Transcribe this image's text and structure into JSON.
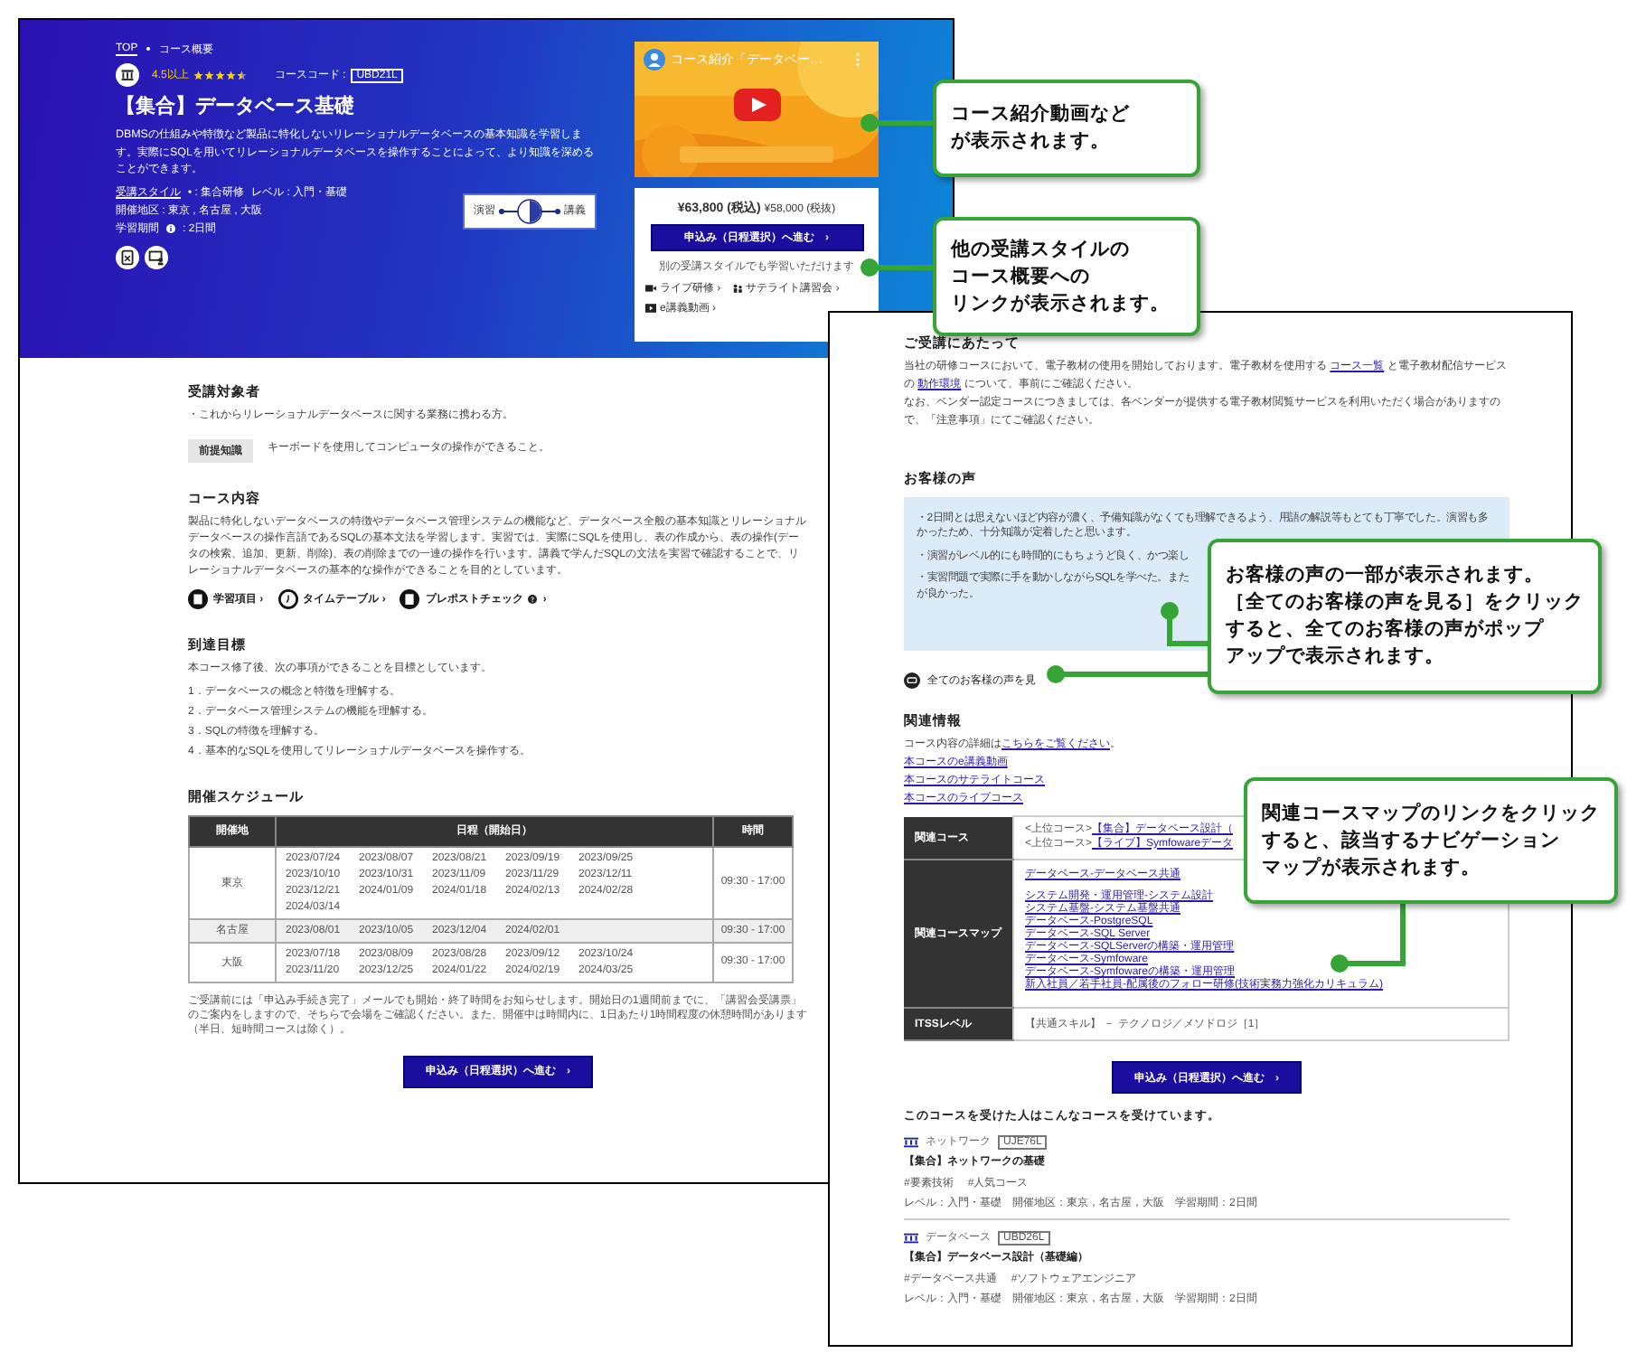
{
  "left_page": {
    "breadcrumb": [
      "TOP",
      "コース概要"
    ],
    "rating": {
      "label": "4.5以上",
      "stars": 4.5
    },
    "code_label": "コースコード :",
    "code": "UBD21L",
    "title": "【集合】データベース基礎",
    "description": "DBMSの仕組みや特徴など製品に特化しないリレーショナルデータベースの基本知識を学習します。実際にSQLを用いてリレーショナルデータベースを操作することによって、より知識を深めることができます。",
    "meta_lines": [
      [
        {
          "kind": "link",
          "text": "受講スタイル"
        },
        {
          "kind": "text",
          "text": "• : 集合研修"
        },
        {
          "kind": "text",
          "text": "レベル : 入門・基礎"
        }
      ],
      [
        {
          "kind": "text",
          "text": "開催地区 : 東京 , 名古屋 , 大阪"
        }
      ],
      [
        {
          "kind": "text",
          "text": "学習期間"
        },
        {
          "kind": "info"
        },
        {
          "kind": "text",
          "text": ": 2日間"
        }
      ]
    ],
    "ratio": {
      "left": "演習",
      "right": "講義",
      "level": 0.5
    },
    "video": {
      "title": "コース紹介「データベー…"
    },
    "price": {
      "main": "¥63,800 (税込)",
      "sub": "¥58,000 (税抜)",
      "button": "申込み（日程選択）へ進む　›",
      "note": "別の受講スタイルでも学習いただけます",
      "styles": [
        {
          "kind": "live",
          "text": "ライブ研修 ›"
        },
        {
          "kind": "satellite",
          "text": "サテライト講習会 ›"
        },
        {
          "kind": "elearning",
          "text": "e講義動画 ›"
        }
      ]
    },
    "audience": {
      "heading": "受講対象者",
      "bullet": "・これからリレーショナルデータベースに関する業務に携わる方。",
      "tag": "前提知識",
      "prereq": "キーボードを使用してコンピュータの操作ができること。"
    },
    "content": {
      "heading": "コース内容",
      "text": "製品に特化しないデータベースの特徴やデータベース管理システムの機能など、データベース全般の基本知識とリレーショナルデータベースの操作言語であるSQLの基本文法を学習します。実習では、実際にSQLを使用し、表の作成から、表の操作(データの検索、追加、更新、削除)、表の削除までの一連の操作を行います。講義で学んだSQLの文法を実習で確認することで、リレーショナルデータベースの基本的な操作ができることを目的としています。",
      "links": [
        {
          "kind": "items",
          "text": "学習項目",
          "arrow": "›",
          "help": false
        },
        {
          "kind": "timetable",
          "text": "タイムテーブル",
          "arrow": "›",
          "help": false
        },
        {
          "kind": "check",
          "text": "プレポストチェック",
          "arrow": "›",
          "help": true
        }
      ]
    },
    "goals": {
      "heading": "到達目標",
      "intro": "本コース修了後、次の事項ができることを目標としています。",
      "items": [
        "1．データベースの概念と特徴を理解する。",
        "2．データベース管理システムの機能を理解する。",
        "3．SQLの特徴を理解する。",
        "4．基本的なSQLを使用してリレーショナルデータベースを操作する。"
      ]
    },
    "schedule": {
      "heading": "開催スケジュール",
      "columns": [
        "開催地",
        "日程（開始日）",
        "時間"
      ],
      "rows": [
        {
          "place": "東京",
          "shaded": false,
          "time": "09:30 - 17:00",
          "dates": [
            "2023/07/24",
            "2023/08/07",
            "2023/08/21",
            "2023/09/19",
            "2023/09/25",
            "2023/10/10",
            "2023/10/31",
            "2023/11/09",
            "2023/11/29",
            "2023/12/11",
            "2023/12/21",
            "2024/01/09",
            "2024/01/18",
            "2024/02/13",
            "2024/02/28",
            "2024/03/14"
          ]
        },
        {
          "place": "名古屋",
          "shaded": true,
          "time": "09:30 - 17:00",
          "dates": [
            "2023/08/01",
            "2023/10/05",
            "2023/12/04",
            "2024/02/01"
          ]
        },
        {
          "place": "大阪",
          "shaded": false,
          "time": "09:30 - 17:00",
          "dates": [
            "2023/07/18",
            "2023/08/09",
            "2023/08/28",
            "2023/09/12",
            "2023/10/24",
            "2023/11/20",
            "2023/12/25",
            "2024/01/22",
            "2024/02/19",
            "2024/03/25"
          ]
        }
      ],
      "note": "ご受講前には「申込み手続き完了」メールでも開始・終了時間をお知らせします。開始日の1週間前までに、「講習会受講票」のご案内をしますので、そちらで会場をご確認ください。また、開催中は時間内に、1日あたり1時間程度の休憩時間があります（半日、短時間コースは除く）。",
      "button": "申込み（日程選択）へ進む　›"
    }
  },
  "right_page": {
    "notice": {
      "heading": "ご受講にあたって",
      "segments": [
        {
          "kind": "text",
          "text": "当社の研修コースにおいて、電子教材の使用を開始しております。電子教材を使用する "
        },
        {
          "kind": "link",
          "text": "コース一覧"
        },
        {
          "kind": "text",
          "text": " と電子教材配信サービスの "
        },
        {
          "kind": "link",
          "text": "動作環境"
        },
        {
          "kind": "text",
          "text": " について、事前にご確認ください。"
        }
      ],
      "note": "なお、ベンダー認定コースにつきましては、各ベンダーが提供する電子教材閲覧サービスを利用いただく場合がありますので、「注意事項」にてご確認ください。"
    },
    "voices": {
      "heading": "お客様の声",
      "items": [
        {
          "lines": [
            "・2日間とは思えないほど内容が濃く、予備知識がなくても理解できるよう、用語の解説等もとても丁寧でした。演習も多かったため、十分知識が定着したと思います。"
          ]
        },
        {
          "lines": [
            "・演習がレベル的にも時間的にもちょうど良く、かつ楽し"
          ]
        },
        {
          "lines": [
            "・実習問題で実際に手を動かしながらSQLを学べた。また",
            "が良かった。"
          ]
        }
      ],
      "more": "全てのお客様の声を見"
    },
    "related": {
      "heading": "関連情報",
      "intro": [
        {
          "kind": "text",
          "text": "コース内容の詳細は"
        },
        {
          "kind": "link",
          "text": "こちらをご覧ください"
        },
        {
          "kind": "text",
          "text": "。"
        }
      ],
      "links": [
        "本コースのe講義動画",
        "本コースのサテライトコース",
        "本コースのライブコース"
      ],
      "rows": [
        {
          "kind": "courses",
          "header": "関連コース",
          "items": [
            {
              "prefix": "<上位コース>",
              "link": "【集合】データベース設計（"
            },
            {
              "prefix": "<上位コース>",
              "link": "【ライブ】Symfowareデータ"
            }
          ]
        },
        {
          "kind": "links",
          "header": "関連コースマップ",
          "groups": [
            [
              "データベース-データベース共通"
            ],
            [
              "システム開発・運用管理-システム設計",
              "システム基盤-システム基盤共通",
              "データベース-PostgreSQL",
              "データベース-SQL Server",
              "データベース-SQLServerの構築・運用管理",
              "データベース-Symfoware",
              "データベース-Symfowareの構築・運用管理",
              "新入社員／若手社員-配属後のフォロー研修(技術実務力強化カリキュラム)"
            ]
          ]
        },
        {
          "kind": "text",
          "header": "ITSSレベル",
          "text": "【共通スキル】 － テクノロジ／メソドロジ［1］"
        }
      ]
    },
    "button": "申込み（日程選択）へ進む　›",
    "others": {
      "heading": "このコースを受けた人はこんなコースを受けています。",
      "courses": [
        {
          "category": "ネットワーク",
          "code": "UJE76L",
          "title": "【集合】ネットワークの基礎",
          "tags": [
            "#要素技術",
            "#人気コース"
          ],
          "meta": "レベル：入門・基礎　開催地区：東京，名古屋，大阪　学習期間：2日間"
        },
        {
          "category": "データベース",
          "code": "UBD26L",
          "title": "【集合】データベース設計（基礎編）",
          "tags": [
            "#データベース共通",
            "#ソフトウェアエンジニア"
          ],
          "meta": "レベル：入門・基礎　開催地区：東京，名古屋，大阪　学習期間：2日間"
        }
      ]
    }
  },
  "callouts": [
    {
      "lines": [
        "コース紹介動画など",
        "が表示されます。"
      ]
    },
    {
      "lines": [
        "他の受講スタイルの",
        "コース概要への",
        "リンクが表示されます。"
      ]
    },
    {
      "lines": [
        "お客様の声の一部が表示されます。",
        "［全てのお客様の声を見る］をクリック",
        "すると、全てのお客様の声がポップ",
        "アップで表示されます。"
      ]
    },
    {
      "lines": [
        "関連コースマップのリンクをクリック",
        "すると、該当するナビゲーション",
        "マップが表示されます。"
      ]
    }
  ]
}
